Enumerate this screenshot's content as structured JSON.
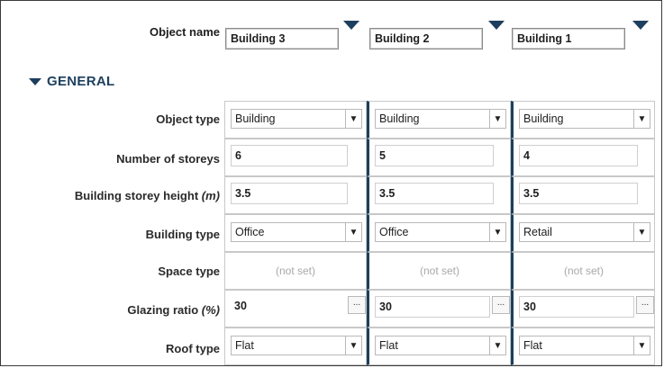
{
  "header": {
    "object_name_label": "Object name",
    "objects": [
      "Building 3",
      "Building 2",
      "Building 1"
    ]
  },
  "section": {
    "title": "GENERAL"
  },
  "rows": {
    "object_type": {
      "label": "Object type",
      "values": [
        "Building",
        "Building",
        "Building"
      ]
    },
    "storeys": {
      "label": "Number of storeys",
      "values": [
        "6",
        "5",
        "4"
      ]
    },
    "storey_height": {
      "label": "Building storey height",
      "unit": "(m)",
      "values": [
        "3.5",
        "3.5",
        "3.5"
      ]
    },
    "building_type": {
      "label": "Building type",
      "values": [
        "Office",
        "Office",
        "Retail"
      ]
    },
    "space_type": {
      "label": "Space type",
      "values": [
        "(not set)",
        "(not set)",
        "(not set)"
      ]
    },
    "glazing": {
      "label": "Glazing ratio",
      "unit": "(%)",
      "values": [
        "30",
        "30",
        "30"
      ],
      "button": "..."
    },
    "roof_type": {
      "label": "Roof type",
      "values": [
        "Flat",
        "Flat",
        "Flat"
      ]
    }
  },
  "icons": {
    "dropdown": "chevron-down-icon",
    "collapse": "triangle-down-icon"
  },
  "colors": {
    "accent": "#1d3f5e"
  }
}
